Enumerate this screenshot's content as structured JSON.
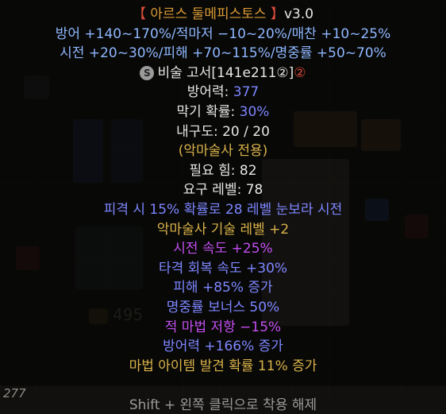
{
  "tooltip": {
    "title": {
      "open": "【",
      "name": " 아르스 둘메피스토스 ",
      "close": "】",
      "version": "v3.0"
    },
    "header_stats": [
      "방어 +140~170%/적마저 −10~20%/매찬 +10~25%",
      "시전 +20~30%/피해 +70~115%/명중률 +50~70%"
    ],
    "base": {
      "icon": "S",
      "name": "비술 고서[141e211②]",
      "tier": "②"
    },
    "defense": {
      "label": "방어력: ",
      "value": "377"
    },
    "block": {
      "label": "막기 확률: ",
      "value": "30%"
    },
    "durability": "내구도: 20 / 20",
    "class_only": "(악마술사 전용)",
    "req_str": "필요 힘: 82",
    "req_level": "요구 레벨: 78",
    "mods": [
      {
        "text": "피격 시 15% 확률로 28 레벨 눈보라 시전",
        "color": "blue"
      },
      {
        "text": "악마술사 기술 레벨 +2",
        "color": "gold"
      },
      {
        "text": "시전 속도 +25%",
        "color": "purple"
      },
      {
        "text": "타격 회복 속도 +30%",
        "color": "blue"
      },
      {
        "text": "피해 +85% 증가",
        "color": "blue"
      },
      {
        "text": "명중률 보너스 50%",
        "color": "blue"
      },
      {
        "text": "적 마법 저항 −15%",
        "color": "purple"
      },
      {
        "text": "방어력 +166% 증가",
        "color": "blue"
      },
      {
        "text": "마법 아이템 발견 확률 11% 증가",
        "color": "gold"
      }
    ]
  },
  "inventory": {
    "gold": "495",
    "corner_value": "277"
  },
  "hint": "Shift + 왼쪽 클릭으로 착용 해제",
  "colors": {
    "gold": "#d9b24a",
    "blue": "#7d86ff",
    "purple": "#c24ef0",
    "red": "#d9483f"
  }
}
